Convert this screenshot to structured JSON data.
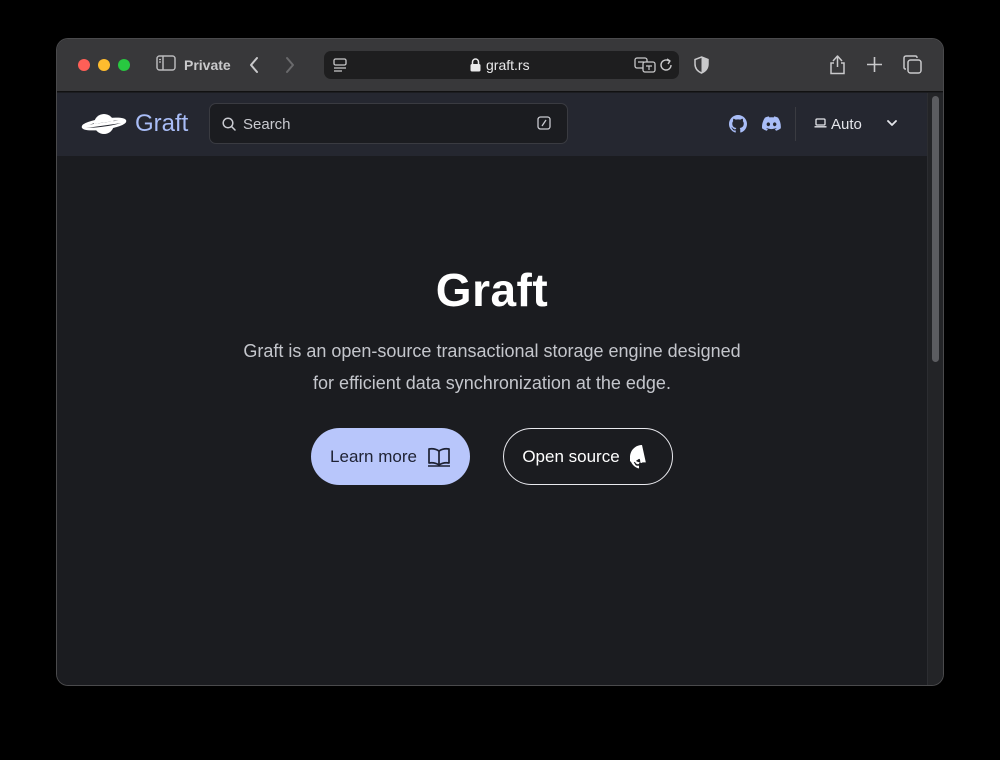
{
  "browser": {
    "private_label": "Private",
    "url": "graft.rs"
  },
  "site": {
    "logo_text": "Graft",
    "search_placeholder": "Search",
    "theme_label": "Auto"
  },
  "hero": {
    "title": "Graft",
    "description": "Graft is an open-source transactional storage engine designed for efficient data synchronization at the edge.",
    "learn_more_label": "Learn more",
    "open_source_label": "Open source"
  },
  "colors": {
    "accent": "#b8c6fb",
    "logo": "#a9bdf7",
    "background": "#1b1c20",
    "header": "#252730"
  },
  "icons": [
    "sidebar-icon",
    "back-icon",
    "forward-icon",
    "page-menu-icon",
    "lock-icon",
    "translate-icon",
    "reload-icon",
    "shield-icon",
    "share-icon",
    "new-tab-icon",
    "tabs-overview-icon",
    "planet-logo-icon",
    "search-icon",
    "keyboard-shortcut-icon",
    "github-icon",
    "discord-icon",
    "laptop-icon",
    "chevron-down-icon",
    "book-icon"
  ]
}
